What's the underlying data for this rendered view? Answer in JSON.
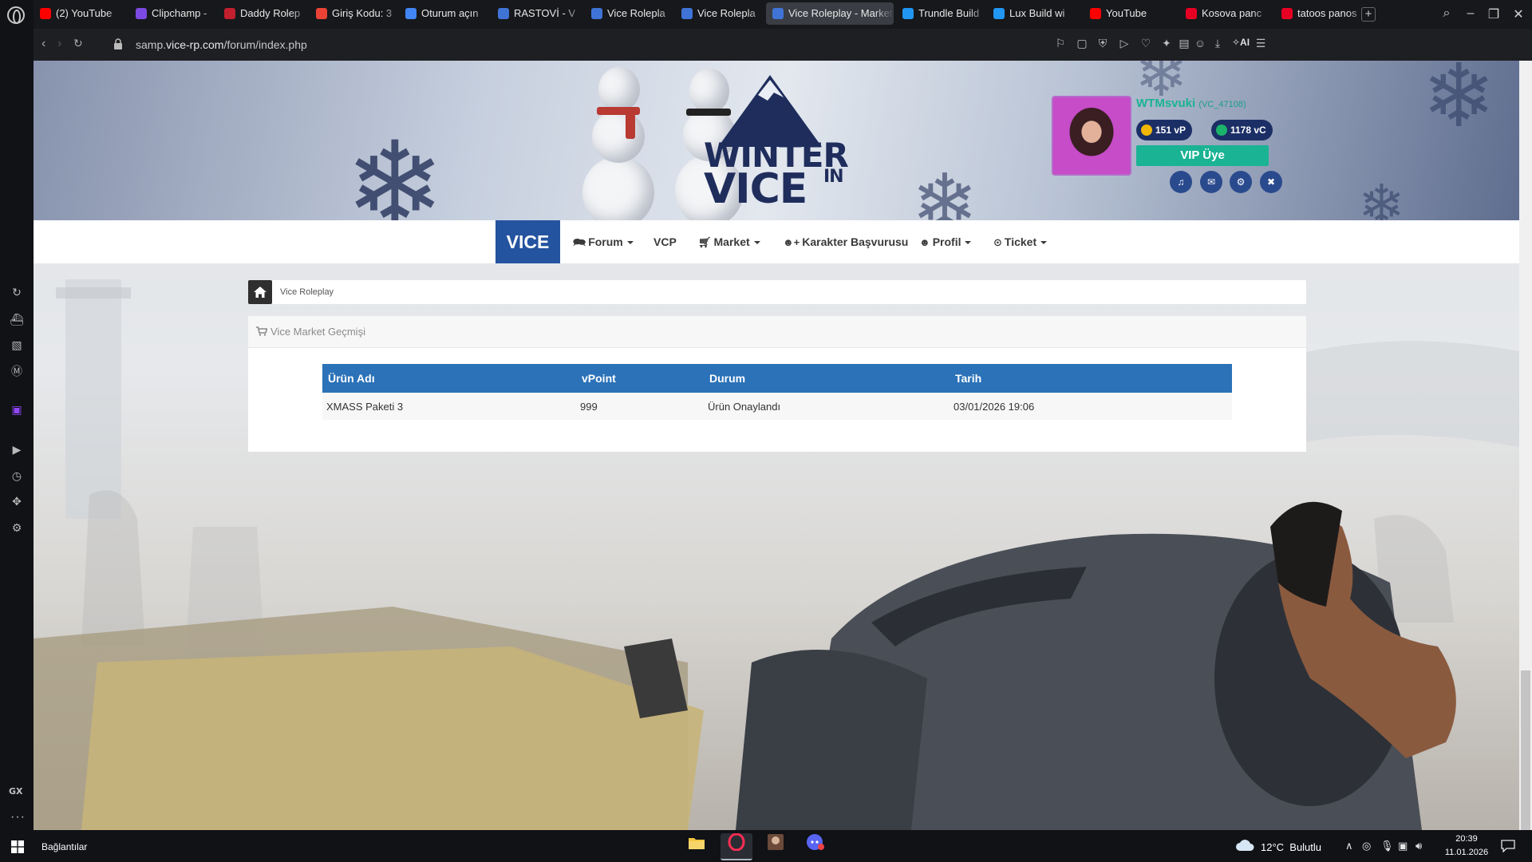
{
  "browser": {
    "tabs": [
      {
        "label": "(2) YouTube",
        "favicon": "youtube-icon",
        "color": "#ff0000"
      },
      {
        "label": "Clipchamp -",
        "favicon": "clipchamp-icon",
        "color": "#7b4ae2"
      },
      {
        "label": "Daddy Rolep",
        "favicon": "daddy-icon",
        "color": "#c21f2f"
      },
      {
        "label": "Giriş Kodu: 3",
        "favicon": "gmail-icon",
        "color": "#ea4335"
      },
      {
        "label": "Oturum açın",
        "favicon": "google-icon",
        "color": "#4285f4"
      },
      {
        "label": "RASTOVİ - V",
        "favicon": "vice-icon",
        "color": "#3f74d6"
      },
      {
        "label": "Vice Rolepla",
        "favicon": "vice-icon",
        "color": "#3f74d6"
      },
      {
        "label": "Vice Rolepla",
        "favicon": "vice-icon",
        "color": "#3f74d6"
      },
      {
        "label": "Vice Roleplay - Market",
        "favicon": "vice-icon",
        "color": "#3f74d6",
        "active": true
      },
      {
        "label": "Trundle Build",
        "favicon": "lol-icon",
        "color": "#2196f3"
      },
      {
        "label": "Lux Build wi",
        "favicon": "lol-icon",
        "color": "#2196f3"
      },
      {
        "label": "YouTube",
        "favicon": "youtube-icon",
        "color": "#ff0000"
      },
      {
        "label": "Kosova panc",
        "favicon": "pinterest-icon",
        "color": "#e60023"
      },
      {
        "label": "tatoos panos",
        "favicon": "pinterest-icon",
        "color": "#e60023"
      }
    ],
    "url_prefix": "samp.",
    "url_domain": "vice-rp.com",
    "url_path": "/forum/index.php",
    "ai_label": "AI"
  },
  "sidebar": {
    "gx_label": "GX",
    "more_label": "···"
  },
  "profile": {
    "username": "WTMsvuki",
    "user_id": "(VC_47108)",
    "vp": "151 vP",
    "vc": "1178 vC",
    "vip": "VIP Üye"
  },
  "logo": {
    "line1": "WINTER",
    "line2": "VICE",
    "suffix": "IN"
  },
  "nav": {
    "brand": "VICE",
    "items": [
      {
        "label": "Forum",
        "icon": "comments-icon",
        "dropdown": true
      },
      {
        "label": "VCP",
        "icon": "",
        "dropdown": false
      },
      {
        "label": "Market",
        "icon": "cart-icon",
        "dropdown": true
      },
      {
        "label": "Karakter Başvurusu",
        "icon": "user-plus-icon",
        "dropdown": false
      },
      {
        "label": "Profil",
        "icon": "user-icon",
        "dropdown": true
      },
      {
        "label": "Ticket",
        "icon": "lifebuoy-icon",
        "dropdown": true
      }
    ]
  },
  "breadcrumb": {
    "item": "Vice Roleplay"
  },
  "panel": {
    "title": "Vice Market Geçmişi"
  },
  "history_table": {
    "headers": [
      "Ürün Adı",
      "vPoint",
      "Durum",
      "Tarih"
    ],
    "rows": [
      [
        "XMASS Paketi 3",
        "999",
        "Ürün Onaylandı",
        "03/01/2026 19:06"
      ]
    ]
  },
  "taskbar": {
    "connections": "Bağlantılar",
    "weather": "12°C  Bulutlu",
    "time": "20:39",
    "date": "11.01.2026"
  },
  "colors": {
    "accent_green": "#1ab394",
    "brand_blue": "#24539f",
    "table_header": "#2b72b8",
    "logo_navy": "#1f2d5c"
  }
}
